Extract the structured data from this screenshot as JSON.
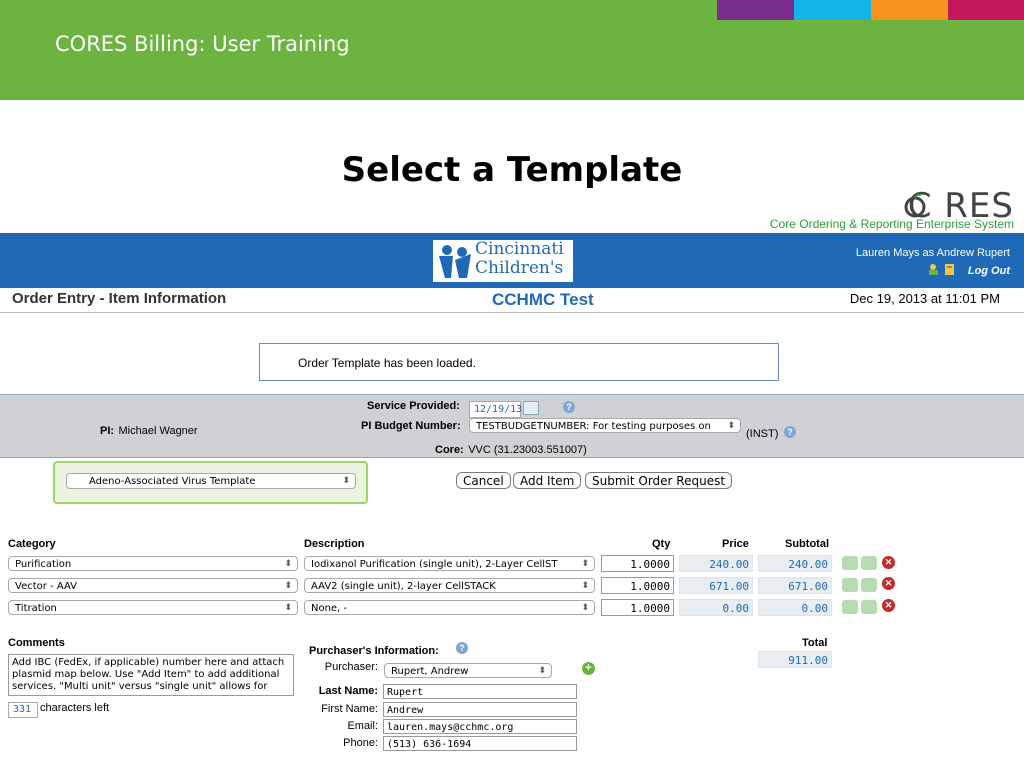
{
  "slide": {
    "title": "CORES Billing: User Training",
    "heading": "Select a Template",
    "stripes": [
      "#7b2d8e",
      "#12b5e5",
      "#f7941d",
      "#c2185b"
    ]
  },
  "logo": {
    "cores": "C RES",
    "tagline": "Core Ordering & Reporting Enterprise System",
    "cch_line1": "Cincinnati",
    "cch_line2": "Children's"
  },
  "header": {
    "user": "Lauren Mays as Andrew Rupert",
    "logout": "Log Out",
    "page_label": "Order Entry - Item Information",
    "test_label": "CCHMC Test",
    "datetime": "Dec 19, 2013 at 11:01 PM"
  },
  "message": "Order Template has been loaded.",
  "info": {
    "pi_label": "PI:",
    "pi_name": "Michael Wagner",
    "service_label": "Service Provided:",
    "service_date": "12/19/13",
    "budget_label": "PI Budget Number:",
    "budget_value": "TESTBUDGETNUMBER: For testing purposes on",
    "budget_suffix": "(INST)",
    "core_label": "Core:",
    "core_value": "VVC (31.23003.551007)"
  },
  "template": {
    "selected": "Adeno-Associated Virus Template"
  },
  "buttons": {
    "cancel": "Cancel",
    "add_item": "Add Item",
    "submit": "Submit Order Request"
  },
  "table": {
    "headers": {
      "category": "Category",
      "description": "Description",
      "qty": "Qty",
      "price": "Price",
      "subtotal": "Subtotal"
    },
    "rows": [
      {
        "category": "Purification",
        "description": "Iodixanol Purification (single unit), 2-Layer CellST",
        "qty": "1.0000",
        "price": "240.00",
        "subtotal": "240.00"
      },
      {
        "category": "Vector - AAV",
        "description": "AAV2 (single unit), 2-layer CellSTACK",
        "qty": "1.0000",
        "price": "671.00",
        "subtotal": "671.00"
      },
      {
        "category": "Titration",
        "description": "None, -",
        "qty": "1.0000",
        "price": "0.00",
        "subtotal": "0.00"
      }
    ],
    "total_label": "Total",
    "total": "911.00"
  },
  "comments": {
    "label": "Comments",
    "text": "Add IBC (FedEx, if applicable) number here and attach plasmid map below. Use \"Add Item\" to add additional services. \"Multi unit\" versus \"single unit\" allows for",
    "chars_left": "331",
    "chars_left_label": "characters left"
  },
  "purchaser": {
    "heading": "Purchaser's Information:",
    "purchaser_label": "Purchaser:",
    "purchaser_value": "Rupert, Andrew",
    "last_label": "Last Name:",
    "last_value": "Rupert",
    "first_label": "First Name:",
    "first_value": "Andrew",
    "email_label": "Email:",
    "email_value": "lauren.mays@cchmc.org",
    "phone_label": "Phone:",
    "phone_value": "(513) 636-1694"
  }
}
